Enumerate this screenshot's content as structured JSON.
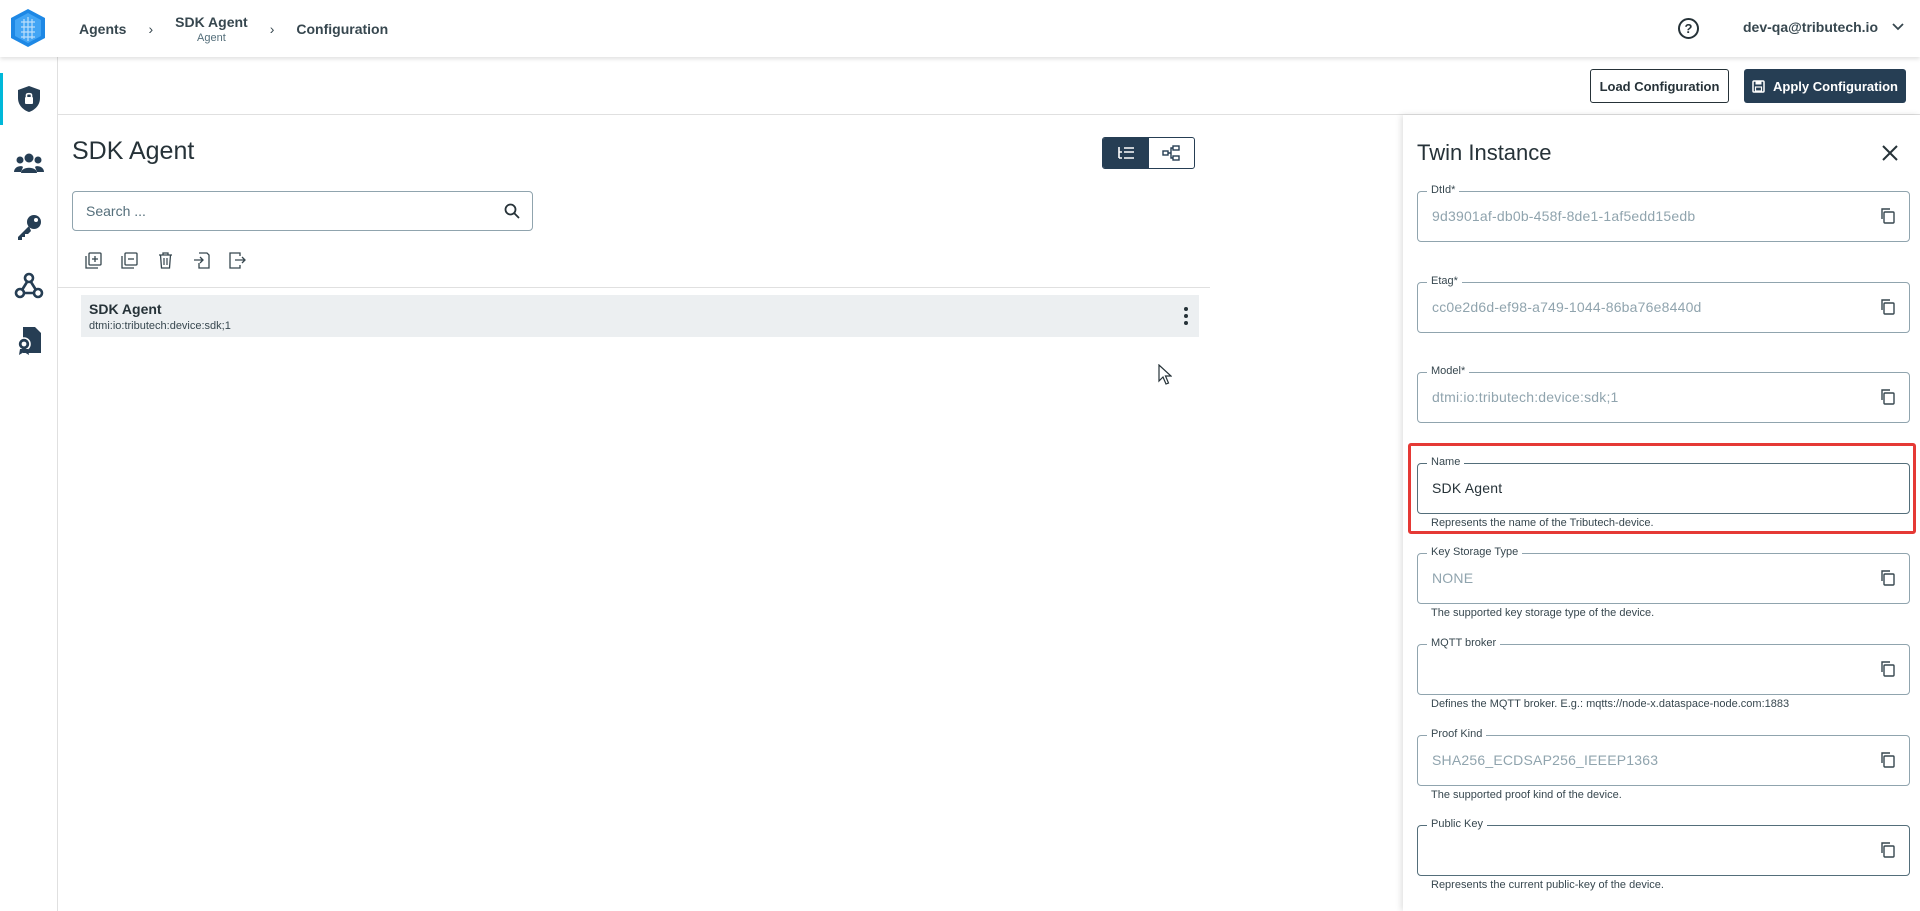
{
  "breadcrumb": {
    "agents": "Agents",
    "sdk_agent": "SDK Agent",
    "sdk_agent_sub": "Agent",
    "configuration": "Configuration"
  },
  "header": {
    "help_glyph": "?",
    "user_email": "dev-qa@tributech.io"
  },
  "sidebar": {
    "items": [
      {
        "icon": "shield-lock-icon",
        "active": true
      },
      {
        "icon": "users-icon",
        "active": false
      },
      {
        "icon": "key-icon",
        "active": false
      },
      {
        "icon": "webhook-icon",
        "active": false
      },
      {
        "icon": "certificate-document-icon",
        "active": false
      }
    ]
  },
  "actions": {
    "load": "Load Configuration",
    "apply": "Apply Configuration"
  },
  "main": {
    "title": "SDK Agent",
    "search_placeholder": "Search ...",
    "tree": [
      {
        "name": "SDK Agent",
        "sub": "dtmi:io:tributech:device:sdk;1"
      }
    ]
  },
  "panel": {
    "title": "Twin Instance",
    "fields": [
      {
        "label": "DtId*",
        "value": "9d3901af-db0b-458f-8de1-1af5edd15edb",
        "help": ""
      },
      {
        "label": "Etag*",
        "value": "cc0e2d6d-ef98-a749-1044-86ba76e8440d",
        "help": ""
      },
      {
        "label": "Model*",
        "value": "dtmi:io:tributech:device:sdk;1",
        "help": ""
      },
      {
        "label": "Name",
        "value": "SDK Agent",
        "help": "Represents the name of the Tributech-device."
      },
      {
        "label": "Key Storage Type",
        "value": "NONE",
        "help": "The supported key storage type of the device."
      },
      {
        "label": "MQTT broker",
        "value": "",
        "help": "Defines the MQTT broker. E.g.: mqtts://node-x.dataspace-node.com:1883"
      },
      {
        "label": "Proof Kind",
        "value": "SHA256_ECDSAP256_IEEEP1363",
        "help": "The supported proof kind of the device."
      },
      {
        "label": "Public Key",
        "value": "",
        "help": "Represents the current public-key of the device."
      }
    ]
  },
  "colors": {
    "primary_dark": "#263e54",
    "active_accent": "#00b8d9",
    "highlight": "#e53935"
  }
}
